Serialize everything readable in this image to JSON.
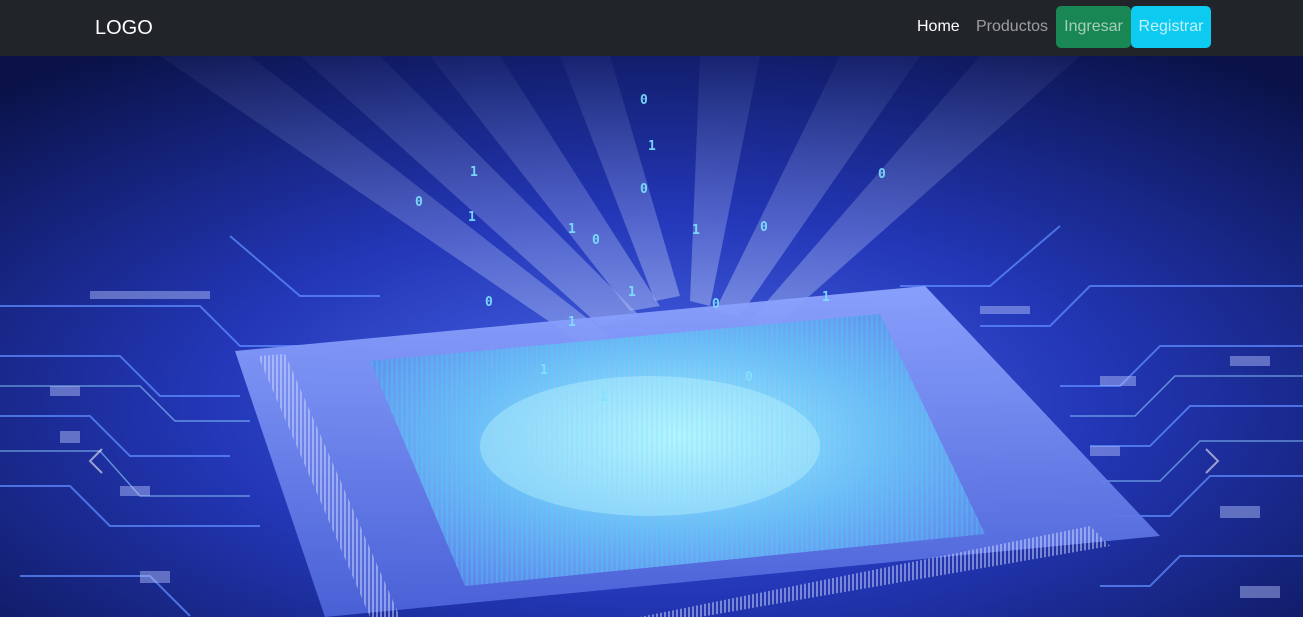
{
  "navbar": {
    "brand": "LOGO",
    "links": [
      {
        "label": "Home",
        "active": true
      },
      {
        "label": "Productos",
        "active": false
      }
    ],
    "buttons": {
      "login_label": "Ingresar",
      "register_label": "Registrar"
    },
    "colors": {
      "background": "#212529",
      "login": "#198754",
      "register": "#0dcaf0"
    }
  },
  "carousel": {
    "slide_image": "circuit-board-processor-chip",
    "prev_icon": "chevron-left-icon",
    "next_icon": "chevron-right-icon",
    "binary_digits": [
      "0",
      "1",
      "0",
      "1",
      "0",
      "1",
      "0",
      "1",
      "0",
      "1",
      "0",
      "0",
      "1",
      "1",
      "0",
      "1",
      "1",
      "0",
      "1"
    ]
  }
}
